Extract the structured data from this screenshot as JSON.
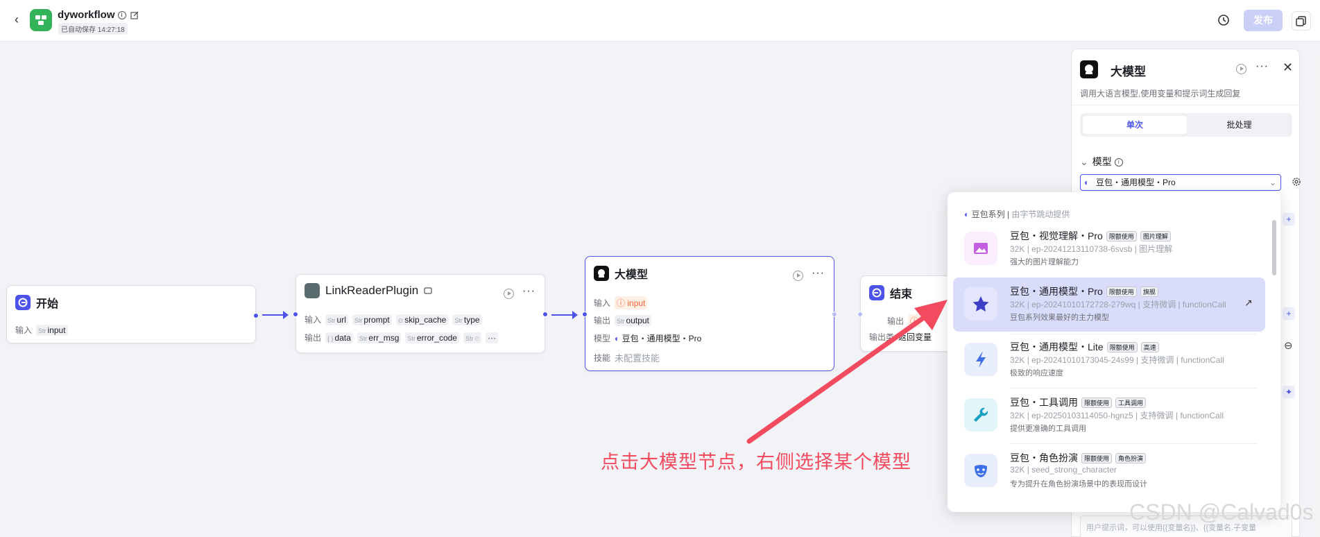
{
  "header": {
    "app_title": "dyworkflow",
    "autosave": "已自动保存 14:27:18",
    "publish_label": "发布"
  },
  "nodes": {
    "start": {
      "title": "开始",
      "input_label": "输入",
      "input_var": "input"
    },
    "plugin": {
      "title": "LinkReaderPlugin",
      "input_label": "输入",
      "inputs": [
        "url",
        "prompt",
        "skip_cache",
        "type"
      ],
      "output_label": "输出",
      "outputs": [
        "data",
        "err_msg",
        "error_code",
        "e"
      ]
    },
    "llm": {
      "title": "大模型",
      "input_label": "输入",
      "input_var": "input",
      "output_label": "输出",
      "output_var": "output",
      "model_label": "模型",
      "model_value": "豆包・通用模型・Pro",
      "skill_label": "技能",
      "skill_value": "未配置技能"
    },
    "end": {
      "title": "结束",
      "output_label": "输出",
      "output_type_label": "输出类",
      "output_type_value": "返回变量"
    }
  },
  "panel": {
    "title": "大模型",
    "description": "调用大语言模型,使用变量和提示词生成回复",
    "tab_single": "单次",
    "tab_batch": "批处理",
    "model_section": "模型",
    "model_selected": "豆包・通用模型・Pro",
    "prompt_placeholder": "用户提示词，可以使用{{变量名}}、{{变量名.子变量"
  },
  "dropdown": {
    "group_name": "豆包系列",
    "group_provider": "由字节跳动提供",
    "options": [
      {
        "name": "豆包・视觉理解・Pro",
        "badges": [
          "限额使用",
          "图片理解"
        ],
        "ctx": "32K",
        "id": "ep-20241213110738-6svsb",
        "extra": "图片理解",
        "desc": "强大的图片理解能力"
      },
      {
        "name": "豆包・通用模型・Pro",
        "badges": [
          "限额使用",
          "旗舰"
        ],
        "ctx": "32K",
        "id": "ep-20241010172728-279wq",
        "extra": "支持微调 | functionCall",
        "desc": "豆包系列效果最好的主力模型"
      },
      {
        "name": "豆包・通用模型・Lite",
        "badges": [
          "限额使用",
          "高速"
        ],
        "ctx": "32K",
        "id": "ep-20241010173045-24s99",
        "extra": "支持微调 | functionCall",
        "desc": "极致的响应速度"
      },
      {
        "name": "豆包・工具调用",
        "badges": [
          "限额使用",
          "工具调用"
        ],
        "ctx": "32K",
        "id": "ep-20250103114050-hgnz5",
        "extra": "支持微调 | functionCall",
        "desc": "提供更准确的工具调用"
      },
      {
        "name": "豆包・角色扮演",
        "badges": [
          "限额使用",
          "角色扮演"
        ],
        "ctx": "32K",
        "id": "seed_strong_character",
        "extra": "",
        "desc": "专为提升在角色扮演场景中的表现而设计"
      }
    ]
  },
  "annotation": "点击大模型节点，右侧选择某个模型",
  "watermark": "CSDN @Calvad0s",
  "type_tag": "Str",
  "obj_tag": "{ }",
  "colors": {
    "accent": "#4d53e8",
    "annotation": "#f24a5e",
    "publish_disabled": "#c9cff7"
  }
}
